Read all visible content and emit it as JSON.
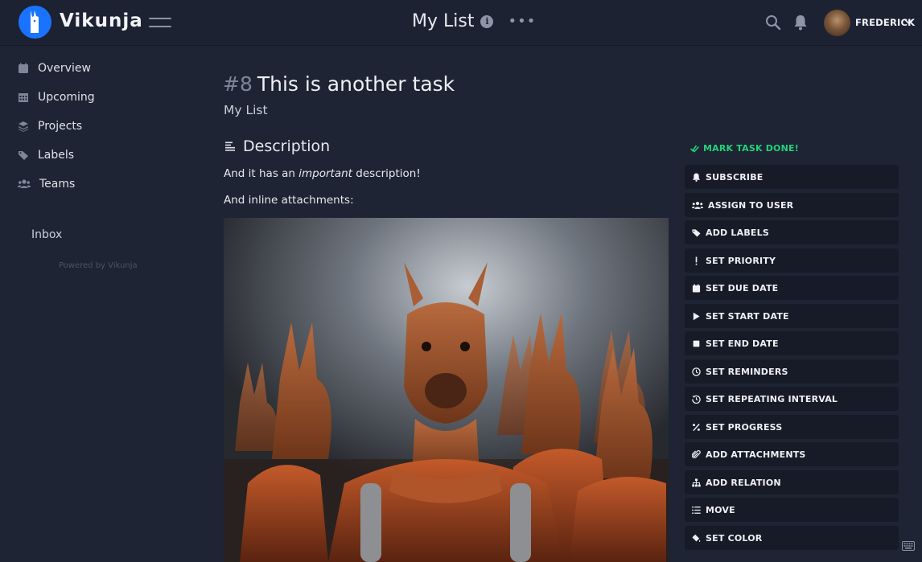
{
  "app": {
    "brand": "Vikunja"
  },
  "header": {
    "list_title": "My List",
    "info_glyph": "i",
    "more_glyph": "•••",
    "user_name": "FREDERICK"
  },
  "sidebar": {
    "items": [
      {
        "label": "Overview",
        "icon": "calendar-icon"
      },
      {
        "label": "Upcoming",
        "icon": "calendar-grid-icon"
      },
      {
        "label": "Projects",
        "icon": "layers-icon"
      },
      {
        "label": "Labels",
        "icon": "tags-icon"
      },
      {
        "label": "Teams",
        "icon": "users-icon"
      }
    ],
    "inbox": "Inbox",
    "powered_by": "Powered by Vikunja"
  },
  "task": {
    "number": "#8",
    "title": "This is another task",
    "project": "My List",
    "description_heading": "Description",
    "description_line1_pre": "And it has an",
    "description_line1_em": "important",
    "description_line1_post": "description!",
    "description_line2": "And inline attachments:"
  },
  "actions": {
    "mark_done": "MARK TASK DONE!",
    "items": [
      {
        "label": "SUBSCRIBE",
        "icon": "bell-icon"
      },
      {
        "label": "ASSIGN TO USER",
        "icon": "users-icon"
      },
      {
        "label": "ADD LABELS",
        "icon": "tags-icon"
      },
      {
        "label": "SET PRIORITY",
        "icon": "exclamation-icon"
      },
      {
        "label": "SET DUE DATE",
        "icon": "calendar-icon"
      },
      {
        "label": "SET START DATE",
        "icon": "play-icon"
      },
      {
        "label": "SET END DATE",
        "icon": "stop-icon"
      },
      {
        "label": "SET REMINDERS",
        "icon": "clock-icon"
      },
      {
        "label": "SET REPEATING INTERVAL",
        "icon": "history-icon"
      },
      {
        "label": "SET PROGRESS",
        "icon": "percent-icon"
      },
      {
        "label": "ADD ATTACHMENTS",
        "icon": "paperclip-icon"
      },
      {
        "label": "ADD RELATION",
        "icon": "sitemap-icon"
      },
      {
        "label": "MOVE",
        "icon": "list-icon"
      },
      {
        "label": "SET COLOR",
        "icon": "fill-drip-icon"
      }
    ]
  },
  "colors": {
    "background": "#1e2433",
    "topbar": "#1c2232",
    "accent_blue": "#1973ff",
    "done_green": "#21d27a",
    "action_bg": "#161b27"
  }
}
